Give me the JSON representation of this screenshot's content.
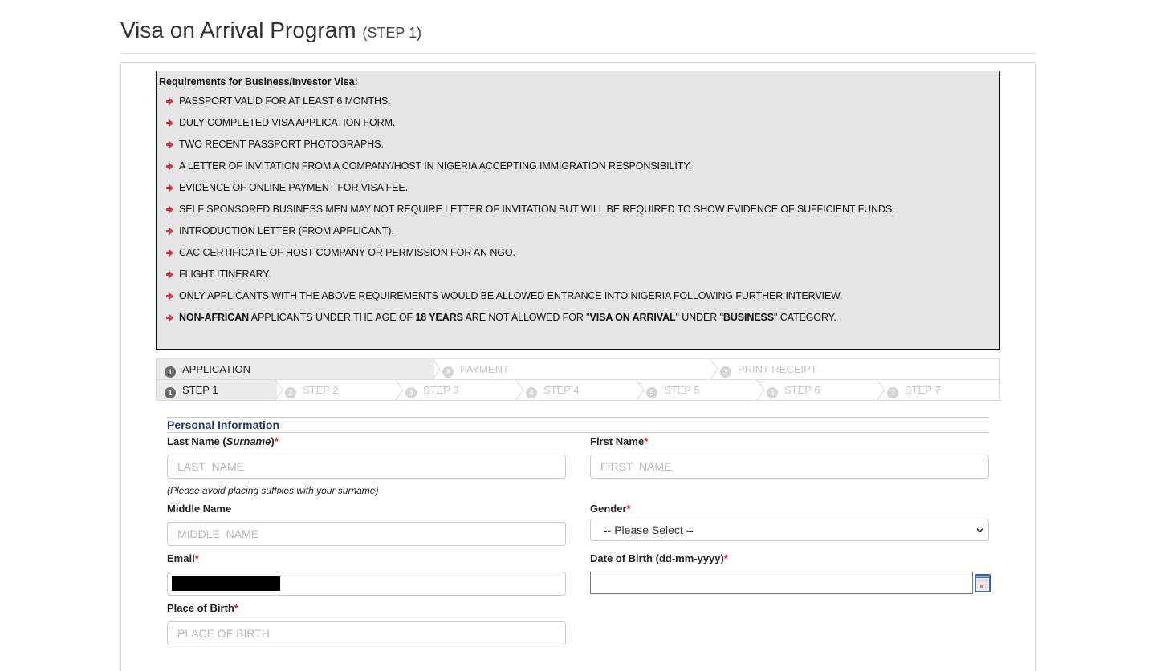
{
  "header": {
    "title": "Visa on Arrival Program",
    "subtitle": "(STEP 1)"
  },
  "requirements": {
    "title": "Requirements for Business/Investor Visa:",
    "items": [
      "PASSPORT VALID FOR AT LEAST 6 MONTHS.",
      "DULY COMPLETED VISA APPLICATION FORM.",
      "TWO RECENT PASSPORT PHOTOGRAPHS.",
      "A LETTER OF INVITATION FROM A COMPANY/HOST IN NIGERIA ACCEPTING IMMIGRATION RESPONSIBILITY.",
      "EVIDENCE OF ONLINE PAYMENT FOR VISA FEE.",
      "SELF SPONSORED BUSINESS MEN MAY NOT REQUIRE LETTER OF INVITATION BUT WILL BE REQUIRED TO SHOW EVIDENCE OF SUFFICIENT FUNDS.",
      "INTRODUCTION LETTER (FROM APPLICANT).",
      "CAC CERTIFICATE OF HOST COMPANY OR PERMISSION FOR AN NGO.",
      "FLIGHT ITINERARY.",
      "ONLY APPLICANTS WITH THE ABOVE REQUIREMENTS WOULD BE ALLOWED ENTRANCE INTO NIGERIA FOLLOWING FURTHER INTERVIEW."
    ],
    "last_item": {
      "part1_bold": "NON-AFRICAN",
      "part2": " APPLICANTS UNDER THE AGE OF ",
      "part3_bold": "18 YEARS",
      "part4": " ARE NOT ALLOWED FOR \"",
      "part5_bold": "VISA ON ARRIVAL",
      "part6": "\" UNDER \"",
      "part7_bold": "BUSINESS",
      "part8": "\" CATEGORY."
    },
    "bullet_icon": "arrow-right-icon",
    "bullet_color": "#e8313a"
  },
  "wizard": {
    "phases": [
      {
        "num": "1",
        "label": "APPLICATION",
        "active": true
      },
      {
        "num": "2",
        "label": "PAYMENT",
        "active": false
      },
      {
        "num": "3",
        "label": "PRINT RECEIPT",
        "active": false
      }
    ],
    "steps": [
      {
        "num": "1",
        "label": "STEP 1",
        "active": true
      },
      {
        "num": "2",
        "label": "STEP 2",
        "active": false
      },
      {
        "num": "3",
        "label": "STEP 3",
        "active": false
      },
      {
        "num": "4",
        "label": "STEP 4",
        "active": false
      },
      {
        "num": "5",
        "label": "STEP 5",
        "active": false
      },
      {
        "num": "6",
        "label": "STEP 6",
        "active": false
      },
      {
        "num": "7",
        "label": "STEP 7",
        "active": false
      }
    ]
  },
  "form": {
    "section_title": "Personal Information",
    "required_mark": "*",
    "last_name": {
      "label_a": "Last Name (",
      "label_b": "Surname",
      "label_c": ")",
      "placeholder": "LAST  NAME",
      "value": "",
      "hint": "(Please avoid placing suffixes with your surname)"
    },
    "first_name": {
      "label": "First Name",
      "placeholder": "FIRST  NAME",
      "value": ""
    },
    "middle_name": {
      "label": "Middle Name",
      "placeholder": "MIDDLE  NAME",
      "value": ""
    },
    "gender": {
      "label": "Gender",
      "selected": "-- Please Select --"
    },
    "email": {
      "label": "Email",
      "value": "[redacted]"
    },
    "dob": {
      "label": "Date of Birth (dd-mm-yyyy)",
      "value": ""
    },
    "place_of_birth": {
      "label": "Place of Birth",
      "placeholder": "PLACE OF BIRTH",
      "value": ""
    }
  }
}
